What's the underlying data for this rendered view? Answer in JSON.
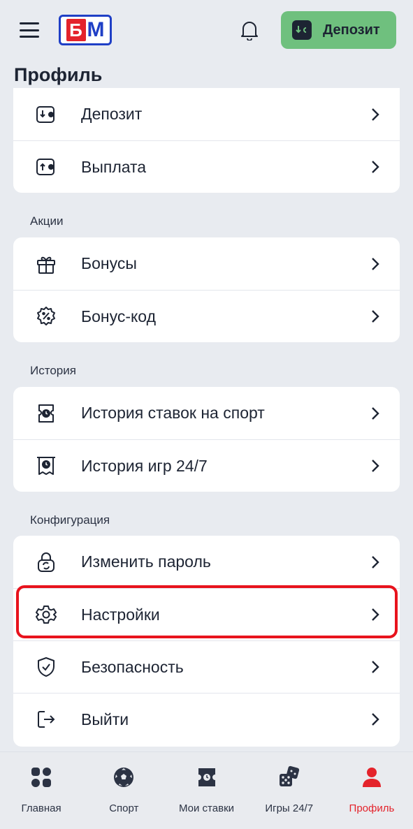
{
  "header": {
    "logo_text_1": "Б",
    "logo_text_2": "М",
    "deposit_label": "Депозит"
  },
  "page_title": "Профиль",
  "sections": {
    "wallet": {
      "items": [
        {
          "label": "Депозит",
          "icon": "deposit-icon"
        },
        {
          "label": "Выплата",
          "icon": "withdraw-icon"
        }
      ]
    },
    "promos": {
      "title": "Акции",
      "items": [
        {
          "label": "Бонусы",
          "icon": "gift-icon"
        },
        {
          "label": "Бонус-код",
          "icon": "promo-code-icon"
        }
      ]
    },
    "history": {
      "title": "История",
      "items": [
        {
          "label": "История ставок на спорт",
          "icon": "bet-history-icon"
        },
        {
          "label": "История игр 24/7",
          "icon": "game-history-icon"
        }
      ]
    },
    "config": {
      "title": "Конфигурация",
      "items": [
        {
          "label": "Изменить пароль",
          "icon": "lock-icon"
        },
        {
          "label": "Настройки",
          "icon": "gear-icon"
        },
        {
          "label": "Безопасность",
          "icon": "shield-icon"
        },
        {
          "label": "Выйти",
          "icon": "logout-icon"
        }
      ]
    }
  },
  "bottom_nav": [
    {
      "label": "Главная",
      "icon": "home-grid-icon"
    },
    {
      "label": "Спорт",
      "icon": "soccer-ball-icon"
    },
    {
      "label": "Мои ставки",
      "icon": "ticket-icon"
    },
    {
      "label": "Игры 24/7",
      "icon": "dice-icon"
    },
    {
      "label": "Профиль",
      "icon": "user-icon",
      "active": true
    }
  ],
  "colors": {
    "accent_green": "#6fc07e",
    "brand_red": "#e4232b",
    "brand_blue": "#1f3fc6",
    "highlight_red": "#e8131d"
  }
}
